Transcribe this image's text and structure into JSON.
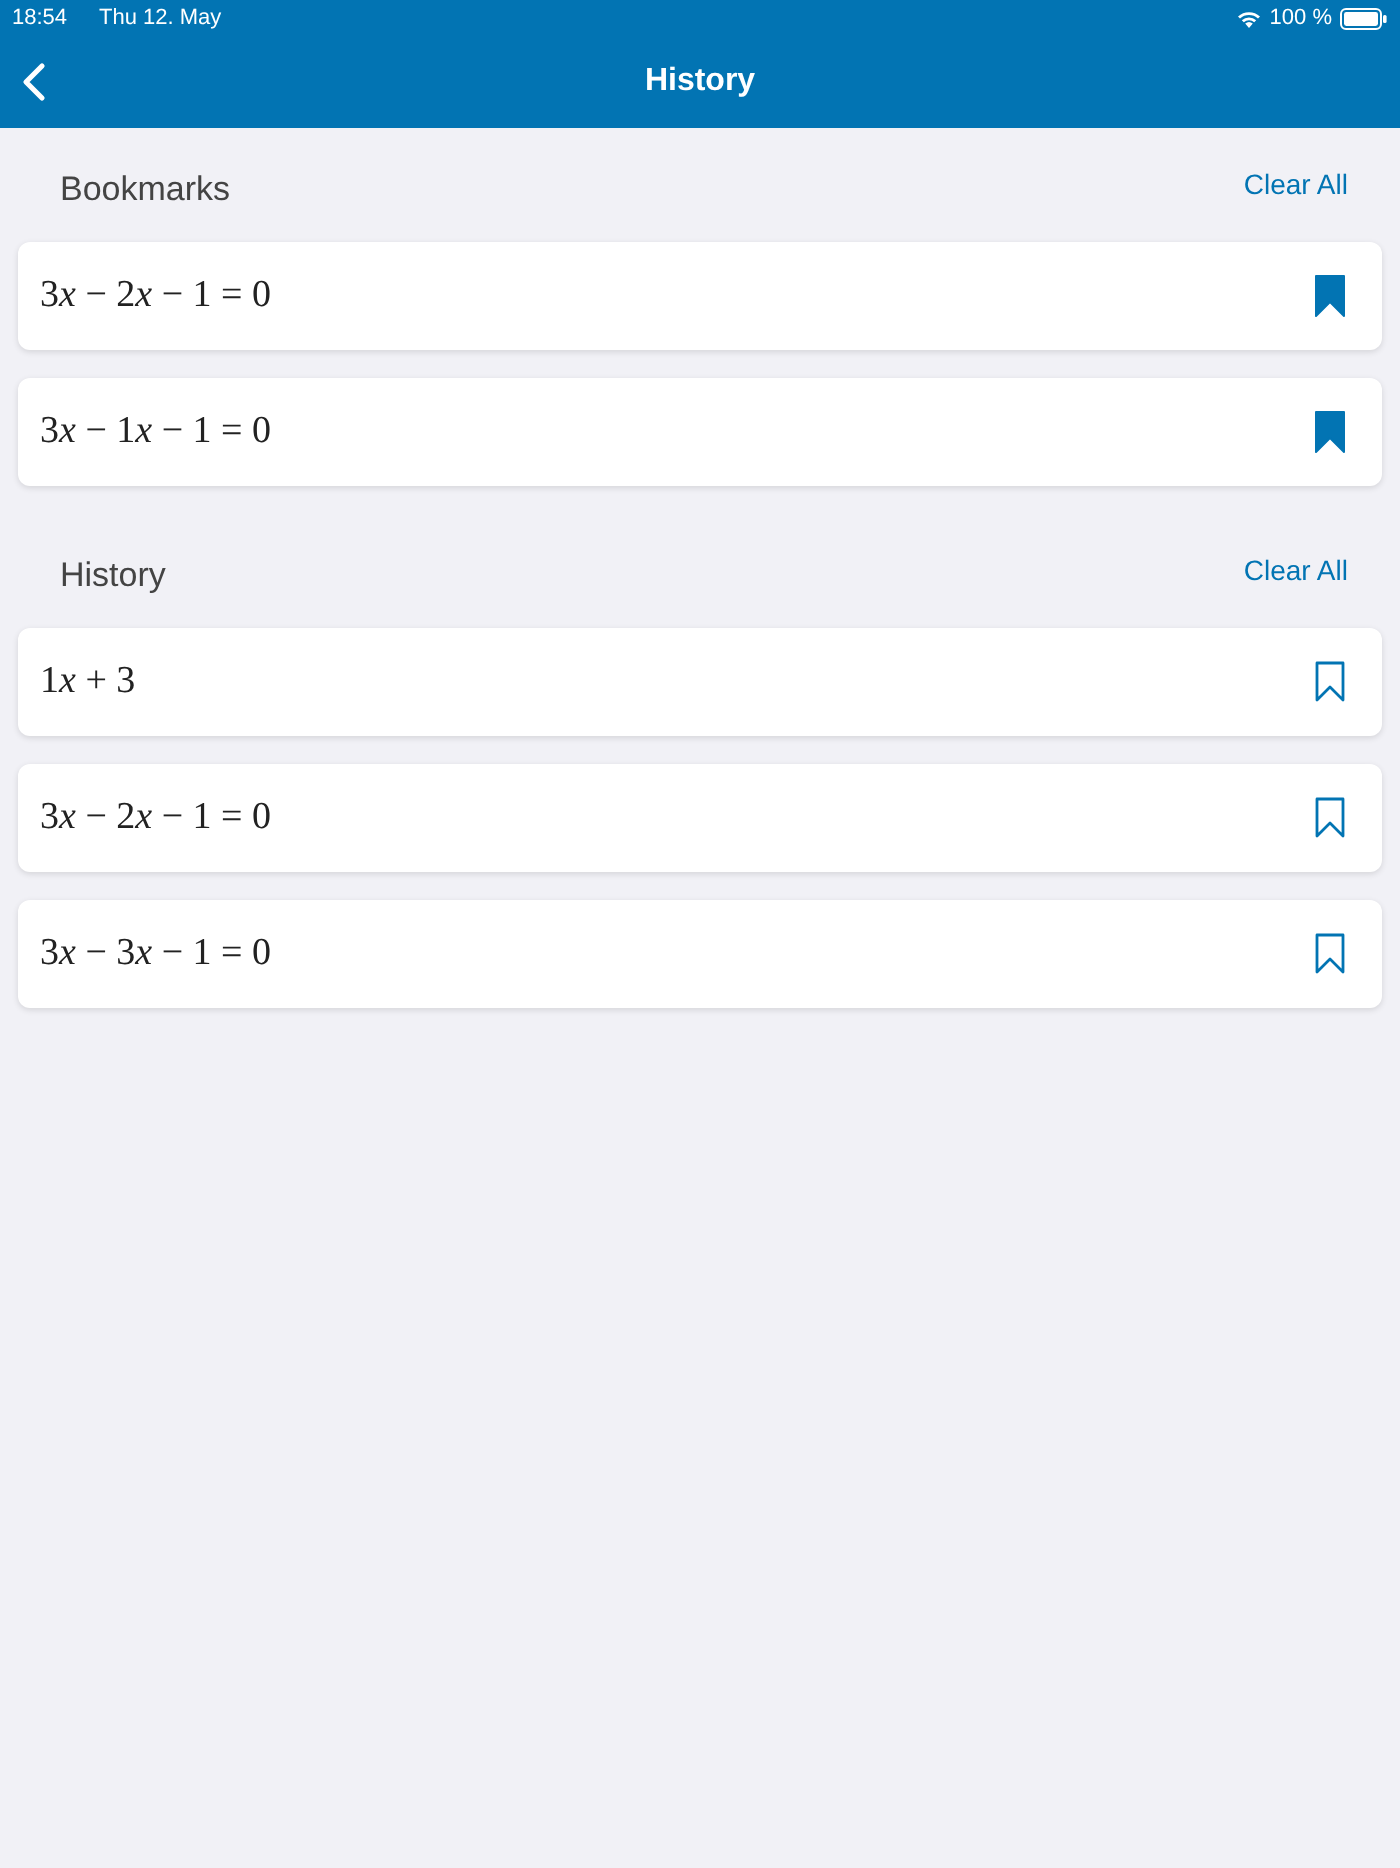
{
  "status_bar": {
    "time": "18:54",
    "date": "Thu 12. May",
    "battery": "100 %"
  },
  "nav_bar": {
    "title": "History"
  },
  "sections": [
    {
      "title": "Bookmarks",
      "action": "Clear All",
      "items": [
        {
          "expression": [
            {
              "kind": "num",
              "text": "3"
            },
            {
              "kind": "var",
              "text": "x"
            },
            {
              "kind": "num",
              "text": " − 2"
            },
            {
              "kind": "var",
              "text": "x"
            },
            {
              "kind": "num",
              "text": " − 1 = 0"
            }
          ],
          "bookmarked": true
        },
        {
          "expression": [
            {
              "kind": "num",
              "text": "3"
            },
            {
              "kind": "var",
              "text": "x"
            },
            {
              "kind": "num",
              "text": " − 1"
            },
            {
              "kind": "var",
              "text": "x"
            },
            {
              "kind": "num",
              "text": " − 1 = 0"
            }
          ],
          "bookmarked": true
        }
      ]
    },
    {
      "title": "History",
      "action": "Clear All",
      "items": [
        {
          "expression": [
            {
              "kind": "num",
              "text": "1"
            },
            {
              "kind": "var",
              "text": "x"
            },
            {
              "kind": "num",
              "text": " + 3"
            }
          ],
          "bookmarked": false
        },
        {
          "expression": [
            {
              "kind": "num",
              "text": "3"
            },
            {
              "kind": "var",
              "text": "x"
            },
            {
              "kind": "num",
              "text": " − 2"
            },
            {
              "kind": "var",
              "text": "x"
            },
            {
              "kind": "num",
              "text": " − 1 = 0"
            }
          ],
          "bookmarked": false
        },
        {
          "expression": [
            {
              "kind": "num",
              "text": "3"
            },
            {
              "kind": "var",
              "text": "x"
            },
            {
              "kind": "num",
              "text": " − 3"
            },
            {
              "kind": "var",
              "text": "x"
            },
            {
              "kind": "num",
              "text": " − 1 = 0"
            }
          ],
          "bookmarked": false
        }
      ]
    }
  ]
}
